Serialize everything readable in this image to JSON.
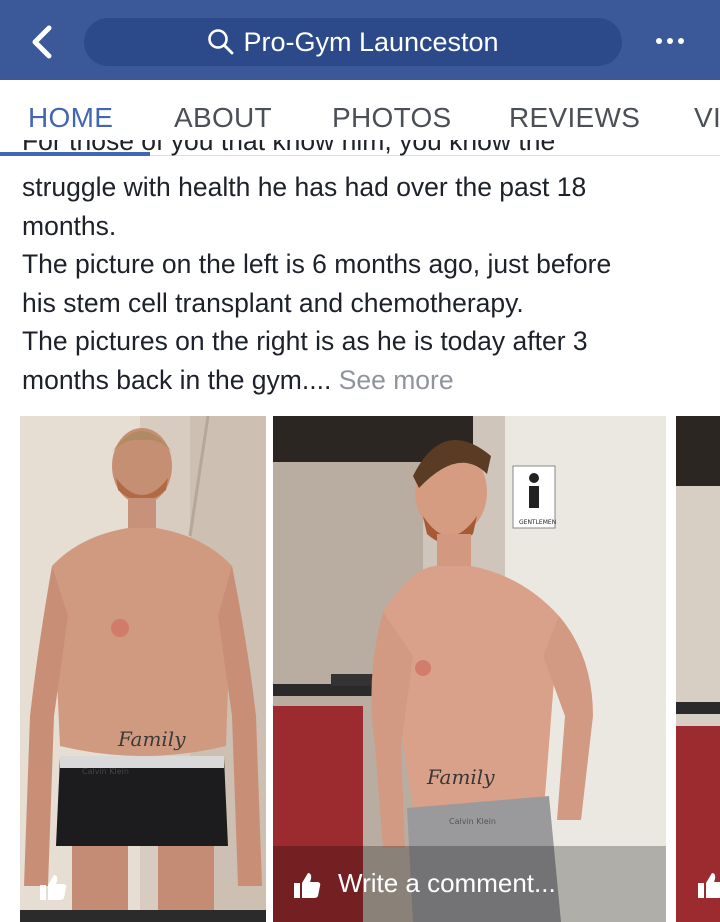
{
  "header": {
    "back_icon": "chevron-left-icon",
    "search_text": "Pro-Gym Launceston",
    "search_icon": "search-icon",
    "more_icon": "more-dots-icon",
    "bar_color": "#3b5998"
  },
  "tabs": [
    {
      "label": "HOME",
      "active": true
    },
    {
      "label": "ABOUT",
      "active": false
    },
    {
      "label": "PHOTOS",
      "active": false
    },
    {
      "label": "REVIEWS",
      "active": false
    },
    {
      "label": "VI",
      "active": false
    }
  ],
  "post": {
    "cut_line": "For those of you that know him, you know the",
    "line1": "struggle with health he has had over the past 18",
    "line2": "months.",
    "line3": "The picture on the left is 6 months ago, just before",
    "line4": "his stem cell transplant and chemotherapy.",
    "line5": "The pictures on the right is as he is today after 3",
    "line6": "months back in the gym....",
    "see_more": "See more"
  },
  "photos": {
    "left_tattoo": "Family",
    "left_waistband": "Calvin Klein",
    "center_tattoo": "Family",
    "center_waistband": "Calvin Klein",
    "sign_text": "GENTLEMEN",
    "like_icon": "thumbs-up-icon",
    "comment_placeholder": "Write a comment..."
  }
}
